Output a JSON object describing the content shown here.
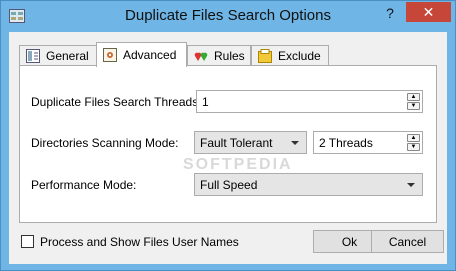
{
  "window": {
    "title": "Duplicate Files Search Options",
    "help_label": "?",
    "close_label": "✕"
  },
  "tabs": [
    {
      "label": "General",
      "icon": "grid-window-icon"
    },
    {
      "label": "Advanced",
      "icon": "settings-box-icon",
      "active": true
    },
    {
      "label": "Rules",
      "icon": "hearts-icon"
    },
    {
      "label": "Exclude",
      "icon": "exclude-box-icon"
    }
  ],
  "form": {
    "threads_label": "Duplicate Files Search Threads:",
    "threads_value": "1",
    "scan_mode_label": "Directories Scanning Mode:",
    "scan_mode_value": "Fault Tolerant",
    "scan_threads_value": "2 Threads",
    "perf_mode_label": "Performance Mode:",
    "perf_mode_value": "Full Speed"
  },
  "footer": {
    "checkbox_label": "Process and Show Files User Names",
    "checkbox_checked": false,
    "ok_label": "Ok",
    "cancel_label": "Cancel"
  },
  "watermark": "SOFTPEDIA"
}
